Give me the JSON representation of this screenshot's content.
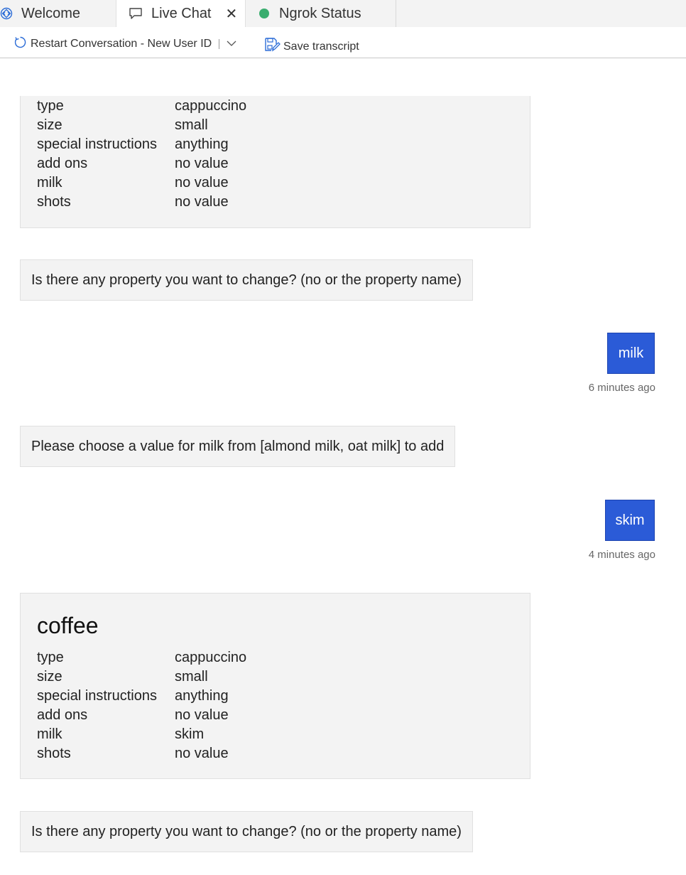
{
  "tabs": [
    {
      "label": "Welcome",
      "icon": "emulator-icon"
    },
    {
      "label": "Live Chat",
      "icon": "chat-bubble-icon",
      "active": true
    },
    {
      "label": "Ngrok Status",
      "icon": "status-dot-icon",
      "status_color": "#3aad6f"
    }
  ],
  "toolbar": {
    "restart_label": "Restart Conversation - New User ID",
    "save_label": "Save transcript"
  },
  "conversation": {
    "card1": {
      "facts": [
        {
          "key": "type",
          "value": "cappuccino"
        },
        {
          "key": "size",
          "value": "small"
        },
        {
          "key": "special instructions",
          "value": "anything"
        },
        {
          "key": "add ons",
          "value": "no value"
        },
        {
          "key": "milk",
          "value": "no value"
        },
        {
          "key": "shots",
          "value": "no value"
        }
      ]
    },
    "bot_msg1": "Is there any property you want to change? (no or the property name)",
    "user_msg1": {
      "text": "milk",
      "time": "6 minutes ago"
    },
    "bot_msg2": "Please choose a value for milk from [almond milk, oat milk] to add",
    "user_msg2": {
      "text": "skim",
      "time": "4 minutes ago"
    },
    "card2": {
      "title": "coffee",
      "facts": [
        {
          "key": "type",
          "value": "cappuccino"
        },
        {
          "key": "size",
          "value": "small"
        },
        {
          "key": "special instructions",
          "value": "anything"
        },
        {
          "key": "add ons",
          "value": "no value"
        },
        {
          "key": "milk",
          "value": "skim"
        },
        {
          "key": "shots",
          "value": "no value"
        }
      ]
    },
    "bot_msg3": "Is there any property you want to change? (no or the property name)"
  },
  "colors": {
    "user_bubble": "#2b5bd7",
    "bot_bubble": "#f3f3f3",
    "accent": "#2b6cd7"
  }
}
